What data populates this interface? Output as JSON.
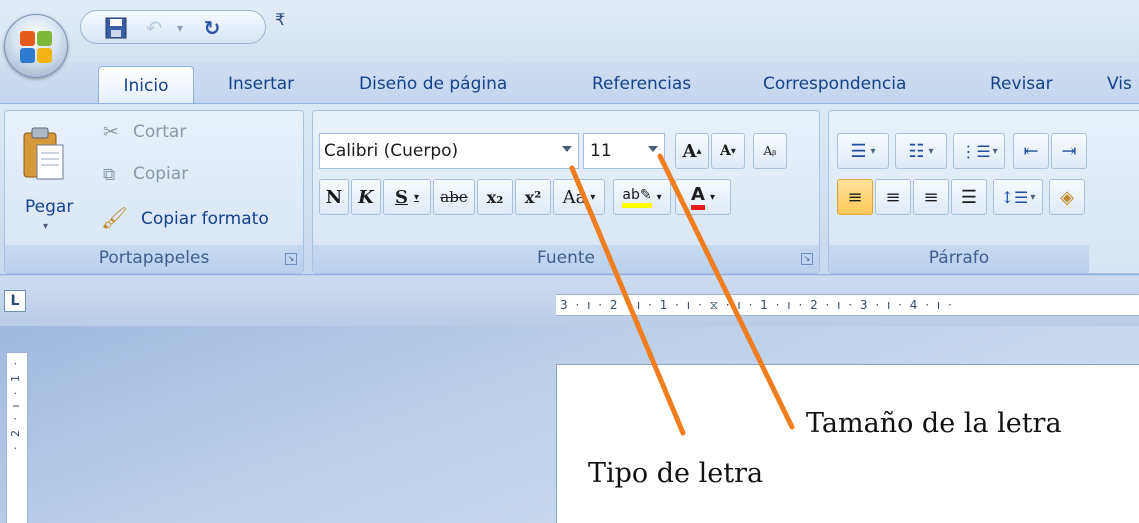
{
  "qat": {
    "icons": [
      "save-icon",
      "undo-icon",
      "redo-icon",
      "customize-qat-icon"
    ]
  },
  "tabs": [
    "Inicio",
    "Insertar",
    "Diseño de página",
    "Referencias",
    "Correspondencia",
    "Revisar",
    "Vis"
  ],
  "active_tab": "Inicio",
  "portapapeles": {
    "paste_label": "Pegar",
    "cut_label": "Cortar",
    "copy_label": "Copiar",
    "format_painter_label": "Copiar formato",
    "group_label": "Portapapeles"
  },
  "fuente": {
    "font_name": "Calibri (Cuerpo)",
    "font_size": "11",
    "bold_label": "N",
    "italic_label": "K",
    "underline_label": "S",
    "strikethrough_label": "abe",
    "subscript_label": "x₂",
    "superscript_label": "x²",
    "change_case_label": "Aa",
    "highlight_label": "ab",
    "font_color_label": "A",
    "grow_font_label": "A",
    "shrink_font_label": "A",
    "group_label": "Fuente"
  },
  "parrafo": {
    "group_label": "Párrafo"
  },
  "ruler": {
    "horizontal_text": "3 · ı · 2 · ı · 1 · ı · ⧖ · ı · 1 · ı · 2 · ı · 3 · ı · 4 · ı ·",
    "vertical_text": "· 2 · ı · 1 ·"
  },
  "annotations": {
    "size_label": "Tamaño de la letra",
    "type_label": "Tipo de letra",
    "arrow_color": "#f07d1e"
  },
  "colors": {
    "accent": "#15428b",
    "selected_button": "#ffc75a",
    "highlight_yellow": "#ffff00",
    "font_color_red": "#e81b1b"
  }
}
